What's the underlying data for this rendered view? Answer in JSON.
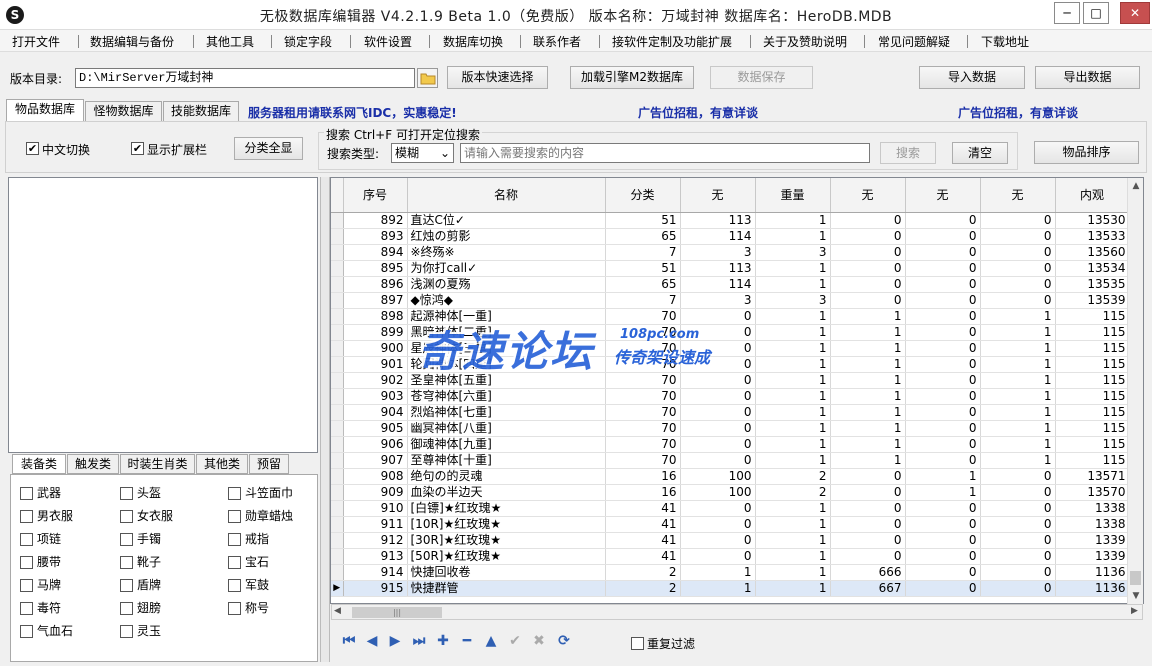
{
  "window": {
    "title": "无极数据库编辑器 V4.2.1.9   Beta 1.0（免费版）   版本名称：万域封神   数据库名：HeroDB.MDB",
    "minimize": "─",
    "maximize": "□",
    "close": "✕"
  },
  "menu": [
    "打开文件",
    "数据编辑与备份",
    "其他工具",
    "锁定字段",
    "软件设置",
    "数据库切换",
    "联系作者",
    "接软件定制及功能扩展",
    "关于及赞助说明",
    "常见问题解疑",
    "下载地址"
  ],
  "toolbar": {
    "dir_label": "版本目录:",
    "dir_value": "D:\\MirServer万域封神",
    "quick_select": "版本快速选择",
    "load_engine": "加载引擎M2数据库",
    "save_data": "数据保存",
    "import_data": "导入数据",
    "export_data": "导出数据"
  },
  "tabs": [
    "物品数据库",
    "怪物数据库",
    "技能数据库"
  ],
  "ads": {
    "server": "服务器租用请联系网飞IDC，实惠稳定!",
    "ad1": "广告位招租，有意详谈",
    "ad2": "广告位招租，有意详谈"
  },
  "options": {
    "chinese_switch": "中文切换",
    "show_ext": "显示扩展栏",
    "show_all": "分类全显",
    "search_group": "搜索  Ctrl+F 可打开定位搜索",
    "search_type_label": "搜索类型:",
    "search_type_value": "模糊",
    "search_placeholder": "请输入需要搜索的内容",
    "search_button": "搜索",
    "clear_button": "清空",
    "sort_button": "物品排序"
  },
  "category_tabs": [
    "装备类",
    "触发类",
    "时装生肖类",
    "其他类",
    "预留"
  ],
  "categories": [
    [
      "武器",
      "头盔",
      "斗笠面巾"
    ],
    [
      "男衣服",
      "女衣服",
      "勋章蜡烛"
    ],
    [
      "项链",
      "手镯",
      "戒指"
    ],
    [
      "腰带",
      "靴子",
      "宝石"
    ],
    [
      "马牌",
      "盾牌",
      "军鼓"
    ],
    [
      "毒符",
      "翅膀",
      "称号"
    ],
    [
      "气血石",
      "灵玉"
    ]
  ],
  "grid": {
    "columns": [
      "序号",
      "名称",
      "分类",
      "无",
      "重量",
      "无",
      "无",
      "无",
      "内观"
    ],
    "rows": [
      [
        "892",
        "直达C位✓",
        "51",
        "113",
        "1",
        "0",
        "0",
        "0",
        "13530"
      ],
      [
        "893",
        "红烛の剪影",
        "65",
        "114",
        "1",
        "0",
        "0",
        "0",
        "13533"
      ],
      [
        "894",
        "※终殇※",
        "7",
        "3",
        "3",
        "0",
        "0",
        "0",
        "13560"
      ],
      [
        "895",
        "为你打call✓",
        "51",
        "113",
        "1",
        "0",
        "0",
        "0",
        "13534"
      ],
      [
        "896",
        "浅渊の夏殇",
        "65",
        "114",
        "1",
        "0",
        "0",
        "0",
        "13535"
      ],
      [
        "897",
        "◆惊鸿◆",
        "7",
        "3",
        "3",
        "0",
        "0",
        "0",
        "13539"
      ],
      [
        "898",
        "起源神体[一重]",
        "70",
        "0",
        "1",
        "1",
        "0",
        "1",
        "115"
      ],
      [
        "899",
        "黑暗神体[二重]",
        "70",
        "0",
        "1",
        "1",
        "0",
        "1",
        "115"
      ],
      [
        "900",
        "星辰神体[三重]",
        "70",
        "0",
        "1",
        "1",
        "0",
        "1",
        "115"
      ],
      [
        "901",
        "轮回神体[四重]",
        "70",
        "0",
        "1",
        "1",
        "0",
        "1",
        "115"
      ],
      [
        "902",
        "圣皇神体[五重]",
        "70",
        "0",
        "1",
        "1",
        "0",
        "1",
        "115"
      ],
      [
        "903",
        "苍穹神体[六重]",
        "70",
        "0",
        "1",
        "1",
        "0",
        "1",
        "115"
      ],
      [
        "904",
        "烈焰神体[七重]",
        "70",
        "0",
        "1",
        "1",
        "0",
        "1",
        "115"
      ],
      [
        "905",
        "幽冥神体[八重]",
        "70",
        "0",
        "1",
        "1",
        "0",
        "1",
        "115"
      ],
      [
        "906",
        "御魂神体[九重]",
        "70",
        "0",
        "1",
        "1",
        "0",
        "1",
        "115"
      ],
      [
        "907",
        "至尊神体[十重]",
        "70",
        "0",
        "1",
        "1",
        "0",
        "1",
        "115"
      ],
      [
        "908",
        "绝句の的灵魂",
        "16",
        "100",
        "2",
        "0",
        "1",
        "0",
        "13571"
      ],
      [
        "909",
        "血染の半边天",
        "16",
        "100",
        "2",
        "0",
        "1",
        "0",
        "13570"
      ],
      [
        "910",
        "[白镖]★红玫瑰★",
        "41",
        "0",
        "1",
        "0",
        "0",
        "0",
        "1338"
      ],
      [
        "911",
        "[10R]★红玫瑰★",
        "41",
        "0",
        "1",
        "0",
        "0",
        "0",
        "1338"
      ],
      [
        "912",
        "[30R]★红玫瑰★",
        "41",
        "0",
        "1",
        "0",
        "0",
        "0",
        "1339"
      ],
      [
        "913",
        "[50R]★红玫瑰★",
        "41",
        "0",
        "1",
        "0",
        "0",
        "0",
        "1339"
      ],
      [
        "914",
        "快捷回收卷",
        "2",
        "1",
        "1",
        "666",
        "0",
        "0",
        "1136"
      ],
      [
        "915",
        "快捷群管",
        "2",
        "1",
        "1",
        "667",
        "0",
        "0",
        "1136"
      ]
    ]
  },
  "navigator": {
    "first": "⏮",
    "prev": "◀",
    "next": "▶",
    "last": "⏭",
    "insert": "✚",
    "delete": "━",
    "edit": "▲",
    "post": "✔",
    "cancel": "✖",
    "refresh": "⟳"
  },
  "dedupe_filter": "重复过滤",
  "watermark": {
    "main": "奇速论坛",
    "domain": "108pc.com",
    "slogan": "传奇架设速成"
  },
  "colors": {
    "ad_text": "#1a2fa8",
    "watermark": "#2a63d8",
    "close_button": "#c75050",
    "selected_row": "#dde8f7"
  }
}
